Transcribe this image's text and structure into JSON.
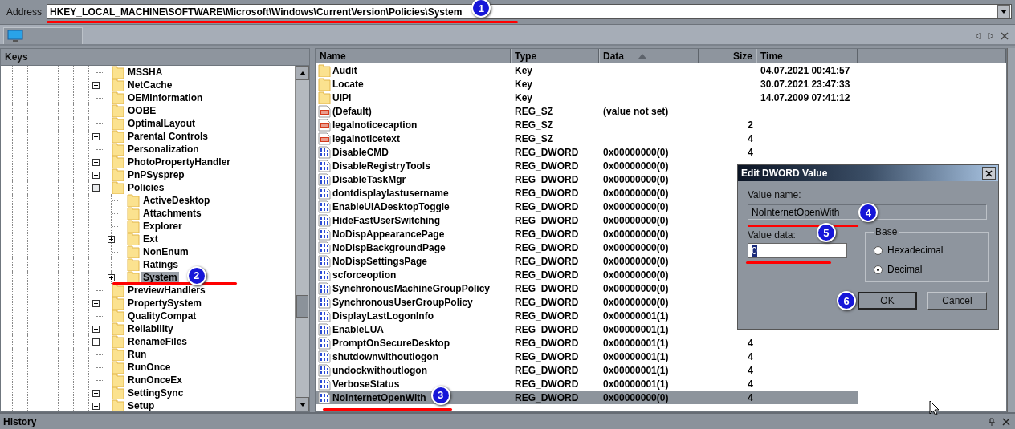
{
  "address": {
    "label": "Address",
    "value": "HKEY_LOCAL_MACHINE\\SOFTWARE\\Microsoft\\Windows\\CurrentVersion\\Policies\\System",
    "annotation": "1"
  },
  "keys_panel": {
    "title": "Keys",
    "tree": [
      {
        "label": "MSSHA",
        "expandable": false,
        "selected": false
      },
      {
        "label": "NetCache",
        "expandable": true,
        "expanded": false,
        "selected": false
      },
      {
        "label": "OEMInformation",
        "expandable": false,
        "selected": false
      },
      {
        "label": "OOBE",
        "expandable": false,
        "selected": false
      },
      {
        "label": "OptimalLayout",
        "expandable": false,
        "selected": false
      },
      {
        "label": "Parental Controls",
        "expandable": true,
        "expanded": false,
        "selected": false
      },
      {
        "label": "Personalization",
        "expandable": false,
        "selected": false
      },
      {
        "label": "PhotoPropertyHandler",
        "expandable": true,
        "expanded": false,
        "selected": false
      },
      {
        "label": "PnPSysprep",
        "expandable": true,
        "expanded": false,
        "selected": false
      },
      {
        "label": "Policies",
        "expandable": true,
        "expanded": true,
        "selected": false,
        "children": [
          {
            "label": "ActiveDesktop",
            "expandable": false,
            "selected": false
          },
          {
            "label": "Attachments",
            "expandable": false,
            "selected": false
          },
          {
            "label": "Explorer",
            "expandable": false,
            "selected": false
          },
          {
            "label": "Ext",
            "expandable": true,
            "expanded": false,
            "selected": false
          },
          {
            "label": "NonEnum",
            "expandable": false,
            "selected": false
          },
          {
            "label": "Ratings",
            "expandable": false,
            "selected": false
          },
          {
            "label": "System",
            "expandable": true,
            "expanded": false,
            "selected": true,
            "annotation": "2"
          }
        ]
      },
      {
        "label": "PreviewHandlers",
        "expandable": false,
        "selected": false
      },
      {
        "label": "PropertySystem",
        "expandable": true,
        "expanded": false,
        "selected": false
      },
      {
        "label": "QualityCompat",
        "expandable": false,
        "selected": false
      },
      {
        "label": "Reliability",
        "expandable": true,
        "expanded": false,
        "selected": false
      },
      {
        "label": "RenameFiles",
        "expandable": true,
        "expanded": false,
        "selected": false
      },
      {
        "label": "Run",
        "expandable": false,
        "selected": false
      },
      {
        "label": "RunOnce",
        "expandable": false,
        "selected": false
      },
      {
        "label": "RunOnceEx",
        "expandable": false,
        "selected": false
      },
      {
        "label": "SettingSync",
        "expandable": true,
        "expanded": false,
        "selected": false
      },
      {
        "label": "Setup",
        "expandable": true,
        "expanded": false,
        "selected": false
      }
    ]
  },
  "values_table": {
    "columns": [
      {
        "label": "Name",
        "sorted": false
      },
      {
        "label": "Type",
        "sorted": false
      },
      {
        "label": "Data",
        "sorted": true
      },
      {
        "label": "Size",
        "sorted": false
      },
      {
        "label": "Time",
        "sorted": false
      }
    ],
    "rows": [
      {
        "kind": "key",
        "name": "Audit",
        "type": "Key",
        "time": "04.07.2021 00:41:57",
        "selected": false
      },
      {
        "kind": "key",
        "name": "Locate",
        "type": "Key",
        "time": "30.07.2021 23:47:33",
        "selected": false
      },
      {
        "kind": "key",
        "name": "UIPI",
        "type": "Key",
        "time": "14.07.2009 07:41:12",
        "selected": false
      },
      {
        "kind": "string",
        "name": "(Default)",
        "type": "REG_SZ",
        "data": "(value not set)",
        "selected": false
      },
      {
        "kind": "string",
        "name": "legalnoticecaption",
        "type": "REG_SZ",
        "size": "2",
        "selected": false
      },
      {
        "kind": "string",
        "name": "legalnoticetext",
        "type": "REG_SZ",
        "size": "4",
        "selected": false
      },
      {
        "kind": "dword",
        "name": "DisableCMD",
        "type": "REG_DWORD",
        "data": "0x00000000(0)",
        "size": "4",
        "selected": false
      },
      {
        "kind": "dword",
        "name": "DisableRegistryTools",
        "type": "REG_DWORD",
        "data": "0x00000000(0)",
        "selected": false
      },
      {
        "kind": "dword",
        "name": "DisableTaskMgr",
        "type": "REG_DWORD",
        "data": "0x00000000(0)",
        "selected": false
      },
      {
        "kind": "dword",
        "name": "dontdisplaylastusername",
        "type": "REG_DWORD",
        "data": "0x00000000(0)",
        "selected": false
      },
      {
        "kind": "dword",
        "name": "EnableUIADesktopToggle",
        "type": "REG_DWORD",
        "data": "0x00000000(0)",
        "selected": false
      },
      {
        "kind": "dword",
        "name": "HideFastUserSwitching",
        "type": "REG_DWORD",
        "data": "0x00000000(0)",
        "selected": false
      },
      {
        "kind": "dword",
        "name": "NoDispAppearancePage",
        "type": "REG_DWORD",
        "data": "0x00000000(0)",
        "selected": false
      },
      {
        "kind": "dword",
        "name": "NoDispBackgroundPage",
        "type": "REG_DWORD",
        "data": "0x00000000(0)",
        "selected": false
      },
      {
        "kind": "dword",
        "name": "NoDispSettingsPage",
        "type": "REG_DWORD",
        "data": "0x00000000(0)",
        "selected": false
      },
      {
        "kind": "dword",
        "name": "scforceoption",
        "type": "REG_DWORD",
        "data": "0x00000000(0)",
        "selected": false
      },
      {
        "kind": "dword",
        "name": "SynchronousMachineGroupPolicy",
        "type": "REG_DWORD",
        "data": "0x00000000(0)",
        "selected": false
      },
      {
        "kind": "dword",
        "name": "SynchronousUserGroupPolicy",
        "type": "REG_DWORD",
        "data": "0x00000000(0)",
        "selected": false
      },
      {
        "kind": "dword",
        "name": "DisplayLastLogonInfo",
        "type": "REG_DWORD",
        "data": "0x00000001(1)",
        "selected": false
      },
      {
        "kind": "dword",
        "name": "EnableLUA",
        "type": "REG_DWORD",
        "data": "0x00000001(1)",
        "selected": false
      },
      {
        "kind": "dword",
        "name": "PromptOnSecureDesktop",
        "type": "REG_DWORD",
        "data": "0x00000001(1)",
        "size": "4",
        "selected": false
      },
      {
        "kind": "dword",
        "name": "shutdownwithoutlogon",
        "type": "REG_DWORD",
        "data": "0x00000001(1)",
        "size": "4",
        "selected": false
      },
      {
        "kind": "dword",
        "name": "undockwithoutlogon",
        "type": "REG_DWORD",
        "data": "0x00000001(1)",
        "size": "4",
        "selected": false
      },
      {
        "kind": "dword",
        "name": "VerboseStatus",
        "type": "REG_DWORD",
        "data": "0x00000001(1)",
        "size": "4",
        "selected": false
      },
      {
        "kind": "dword",
        "name": "NoInternetOpenWith",
        "type": "REG_DWORD",
        "data": "0x00000000(0)",
        "size": "4",
        "selected": true,
        "annotation": "3"
      }
    ]
  },
  "dialog": {
    "title": "Edit DWORD Value",
    "value_name_label": "Value name:",
    "value_name": "NoInternetOpenWith",
    "value_name_annotation": "4",
    "value_data_label": "Value data:",
    "value_data": "0",
    "value_data_annotation": "5",
    "base": {
      "title": "Base",
      "options": [
        {
          "label": "Hexadecimal",
          "selected": false
        },
        {
          "label": "Decimal",
          "selected": true
        }
      ]
    },
    "buttons": [
      {
        "label": "OK",
        "default": true,
        "annotation": "6"
      },
      {
        "label": "Cancel",
        "default": false
      }
    ]
  },
  "history_panel": {
    "title": "History"
  }
}
